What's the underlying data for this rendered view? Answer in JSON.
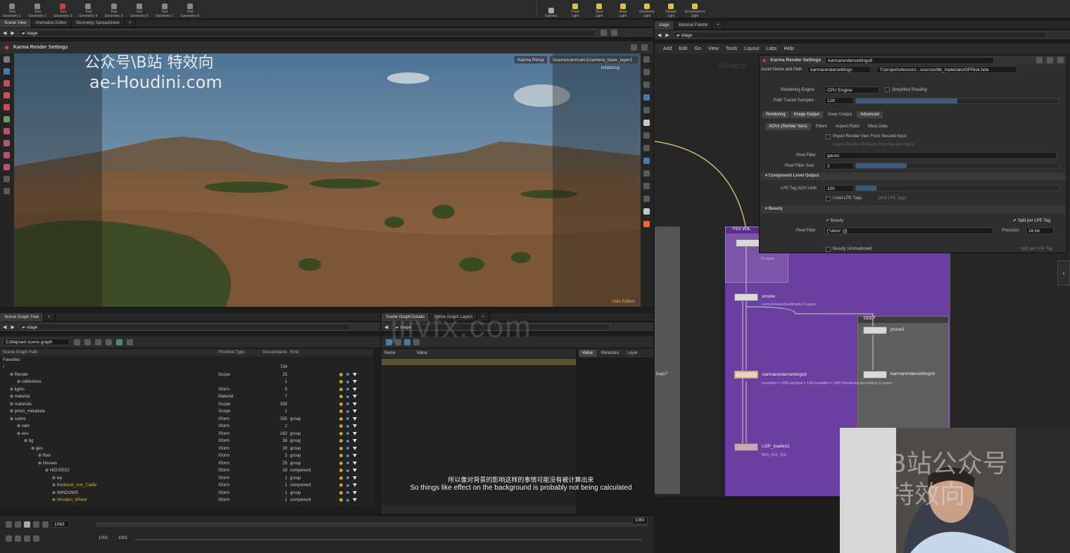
{
  "shelf": {
    "tools_left": [
      {
        "label": "Tool\nGeometry 1"
      },
      {
        "label": "Tool\nGeometry 2"
      },
      {
        "label": "Tool\nGeometry 3"
      },
      {
        "label": "Tool\nGeometry 4"
      },
      {
        "label": "Tool\nGeometry 5"
      },
      {
        "label": "Tool\nGeometry 6"
      },
      {
        "label": "Tool\nGeometry 7"
      },
      {
        "label": "Tool\nGeometry 8"
      }
    ],
    "tools_right": [
      {
        "label": "Camera"
      },
      {
        "label": "Point Light"
      },
      {
        "label": "Spot Light"
      },
      {
        "label": "Area Light"
      },
      {
        "label": "Geometry Light"
      },
      {
        "label": "Distant Light"
      },
      {
        "label": "Environment Light"
      }
    ]
  },
  "left": {
    "tabs": [
      "Scene View",
      "Animation Editor",
      "Geometry Spreadsheet"
    ],
    "path": "stage",
    "viewport_title": "Karma Render Settings",
    "persp": "Karma Persp",
    "camera": "/scene/cam/cam1/camera_base_layer1",
    "status": "Initializing",
    "indie": "Indie Edition"
  },
  "watermark": {
    "line1": "公众号\\B站 特效向",
    "line2": "ae-Houdini.com",
    "center": "jiivfx.com",
    "cam_text": "B站公众号\n特效向"
  },
  "subtitle": {
    "zh": "所以像对背景的影响这样的事情可能没有被计算出来",
    "en": "So things like effect on the background is probably not being calculated"
  },
  "scene_graph": {
    "tab": "Scene Graph Tree",
    "path": "stage",
    "filter": "Collapsed scene graph",
    "headers": [
      "Scene Graph Path",
      "Primitive Type",
      "Descendants",
      "Kind"
    ],
    "rows": [
      {
        "name": "Favorites",
        "type": "",
        "desc": "",
        "kind": "",
        "indent": 0
      },
      {
        "name": "/",
        "type": "",
        "desc": "724",
        "kind": "",
        "indent": 0
      },
      {
        "name": "Render",
        "type": "Scope",
        "desc": "25",
        "kind": "",
        "indent": 1
      },
      {
        "name": "collections",
        "type": "",
        "desc": "1",
        "kind": "",
        "indent": 2
      },
      {
        "name": "lights",
        "type": "Xform",
        "desc": "5",
        "kind": "",
        "indent": 1
      },
      {
        "name": "material",
        "type": "Material",
        "desc": "7",
        "kind": "",
        "indent": 1
      },
      {
        "name": "materials",
        "type": "Scope",
        "desc": "330",
        "kind": "",
        "indent": 1
      },
      {
        "name": "prism_metadata",
        "type": "Scope",
        "desc": "1",
        "kind": "",
        "indent": 1
      },
      {
        "name": "scene",
        "type": "Xform",
        "desc": "335",
        "kind": "group",
        "indent": 1
      },
      {
        "name": "cam",
        "type": "Xform",
        "desc": "2",
        "kind": "",
        "indent": 2
      },
      {
        "name": "env",
        "type": "Xform",
        "desc": "182",
        "kind": "group",
        "indent": 2
      },
      {
        "name": "bg",
        "type": "Xform",
        "desc": "38",
        "kind": "group",
        "indent": 3
      },
      {
        "name": "geo",
        "type": "Xform",
        "desc": "29",
        "kind": "group",
        "indent": 4
      },
      {
        "name": "floor",
        "type": "Xform",
        "desc": "3",
        "kind": "group",
        "indent": 5
      },
      {
        "name": "Houses",
        "type": "Xform",
        "desc": "25",
        "kind": "group",
        "indent": 5
      },
      {
        "name": "HOUSE02",
        "type": "Xform",
        "desc": "19",
        "kind": "component",
        "indent": 6
      },
      {
        "name": "ivy",
        "type": "Xform",
        "desc": "1",
        "kind": "group",
        "indent": 7
      },
      {
        "name": "Medieval_Iron_Cable",
        "type": "Xform",
        "desc": "1",
        "kind": "component",
        "indent": 7
      },
      {
        "name": "WINDOWS",
        "type": "Xform",
        "desc": "1",
        "kind": "group",
        "indent": 7
      },
      {
        "name": "Wooden_Wheel",
        "type": "Xform",
        "desc": "1",
        "kind": "component",
        "indent": 7
      }
    ]
  },
  "scene_detail": {
    "tabs": [
      "Scene Graph Details",
      "Scene Graph Layers"
    ],
    "path": "stage",
    "headers": [
      "Name",
      "Value"
    ],
    "right_tabs": [
      "Value",
      "Metadata",
      "Layer"
    ]
  },
  "timeline": {
    "frame": "1063",
    "start1": "1001",
    "start2": "1001",
    "end": "1063"
  },
  "network": {
    "tabs": [
      "stage",
      "Material Palette"
    ],
    "path": "stage",
    "menu": [
      "Add",
      "Edit",
      "Go",
      "View",
      "Tools",
      "Layout",
      "Labs",
      "Help"
    ],
    "bg_text": "Solaris",
    "nodes": {
      "fg_vol": "FG1 VOL",
      "smoke": "smoke",
      "deep": "DEEP",
      "prune": "prune1",
      "krs8": "karmarendersettings8",
      "krs9": "karmarendersettings9",
      "lop": "LOP_loaded1",
      "box_label": "bags7"
    },
    "smoke_sub": "scene/smoke/cloud/matte\n0 Layers",
    "krs_sub": "resolution = 1080\nsamples = 128\nresolution = 1080\n/Render/rendersettings\n0 Layers",
    "lop_sub": "BKG_FG1_VOL",
    "side_text": "0 Layers"
  },
  "params": {
    "title_type": "Karma Render Settings",
    "node_name": "karmarendersettings8",
    "asset_label": "Asset Name and Path",
    "asset_value": "karmarendersettings",
    "asset_path": "T:/projects/lesson/...sources/lib_materials/OPRisk.hda",
    "engine_label": "Rendering Engine",
    "engine_value": "CPU Engine",
    "simplified": "Simplified Shading",
    "samples_label": "Path Traced Samples",
    "samples_value": "128",
    "tabs": [
      "Rendering",
      "Image Output",
      "Deep Output",
      "Advanced"
    ],
    "subtabs": [
      "AOVs (Render Vars)",
      "Filters",
      "Aspect Ratio",
      "Meta Data"
    ],
    "import_vars": "Import Render Vars From Second Input",
    "import_note": "Import Render Products from Second Input",
    "pixel_filter_label": "Pixel Filter",
    "pixel_filter_value": "gauss",
    "pixel_filter_size_label": "Pixel Filter Size",
    "pixel_filter_size_value": "2",
    "comp_section": "Component Level Output",
    "lpe_label": "LPE Tag AOV Limit",
    "lpe_value": "100",
    "used_lpe": "Used LPE Tags",
    "omit_lpe": "Omit LPE Tags",
    "beauty_section": "Beauty",
    "beauty": "Beauty",
    "split_lpe": "Split per LPE Tag",
    "pixel_filter2_label": "Pixel Filter",
    "pixel_filter2_value": "[\"ubox\",{}]",
    "precision_label": "Precision",
    "precision_value": "16 bit",
    "beauty_unshadowed": "Beauty Unshadowed",
    "split_lpe2": "Split per LPE Tag"
  }
}
